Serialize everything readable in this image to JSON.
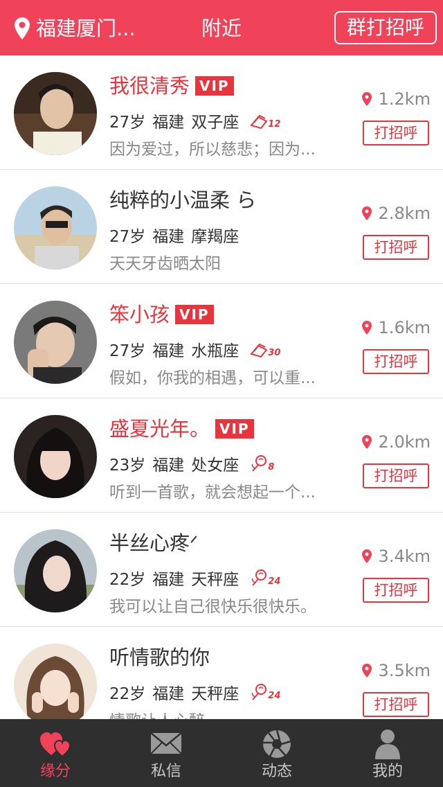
{
  "header": {
    "location": "福建厦门...",
    "title": "附近",
    "greet_all_label": "群打招呼"
  },
  "users": [
    {
      "name": "我很清秀",
      "vip": true,
      "vip_label": "VIP",
      "age": "27岁",
      "province": "福建",
      "zodiac": "双子座",
      "gift_icon": "gold-bar-icon",
      "gift_count": "12",
      "signature": "因为爱过，所以慈悲；因为...",
      "distance": "1.2km",
      "greet_label": "打招呼"
    },
    {
      "name": "纯粹的小温柔 ら",
      "vip": false,
      "age": "27岁",
      "province": "福建",
      "zodiac": "摩羯座",
      "signature": "天天牙齿晒太阳",
      "distance": "2.8km",
      "greet_label": "打招呼"
    },
    {
      "name": "笨小孩",
      "vip": true,
      "vip_label": "VIP",
      "age": "27岁",
      "province": "福建",
      "zodiac": "水瓶座",
      "gift_icon": "gold-bar-icon",
      "gift_count": "30",
      "signature": "假如，你我的相遇，可以重...",
      "distance": "1.6km",
      "greet_label": "打招呼"
    },
    {
      "name": "盛夏光年。",
      "vip": true,
      "vip_label": "VIP",
      "age": "23岁",
      "province": "福建",
      "zodiac": "处女座",
      "gift_icon": "rose-icon",
      "gift_count": "8",
      "signature": "听到一首歌，就会想起一个...",
      "distance": "2.0km",
      "greet_label": "打招呼"
    },
    {
      "name": "半丝心疼ᐟ",
      "vip": false,
      "age": "22岁",
      "province": "福建",
      "zodiac": "天秤座",
      "gift_icon": "rose-icon",
      "gift_count": "24",
      "signature": "我可以让自己很快乐很快乐。",
      "distance": "3.4km",
      "greet_label": "打招呼"
    },
    {
      "name": "听情歌的你",
      "vip": false,
      "age": "22岁",
      "province": "福建",
      "zodiac": "天秤座",
      "gift_icon": "rose-icon",
      "gift_count": "24",
      "signature": "情歌让人心醉。",
      "distance": "3.5km",
      "greet_label": "打招呼"
    }
  ],
  "tabs": [
    {
      "label": "缘分",
      "icon": "hearts-icon",
      "active": true
    },
    {
      "label": "私信",
      "icon": "envelope-icon",
      "active": false
    },
    {
      "label": "动态",
      "icon": "aperture-icon",
      "active": false
    },
    {
      "label": "我的",
      "icon": "person-icon",
      "active": false
    }
  ],
  "colors": {
    "brand": "#f0435a",
    "vip": "#e8343c",
    "tabbar": "#2f2f2f"
  }
}
